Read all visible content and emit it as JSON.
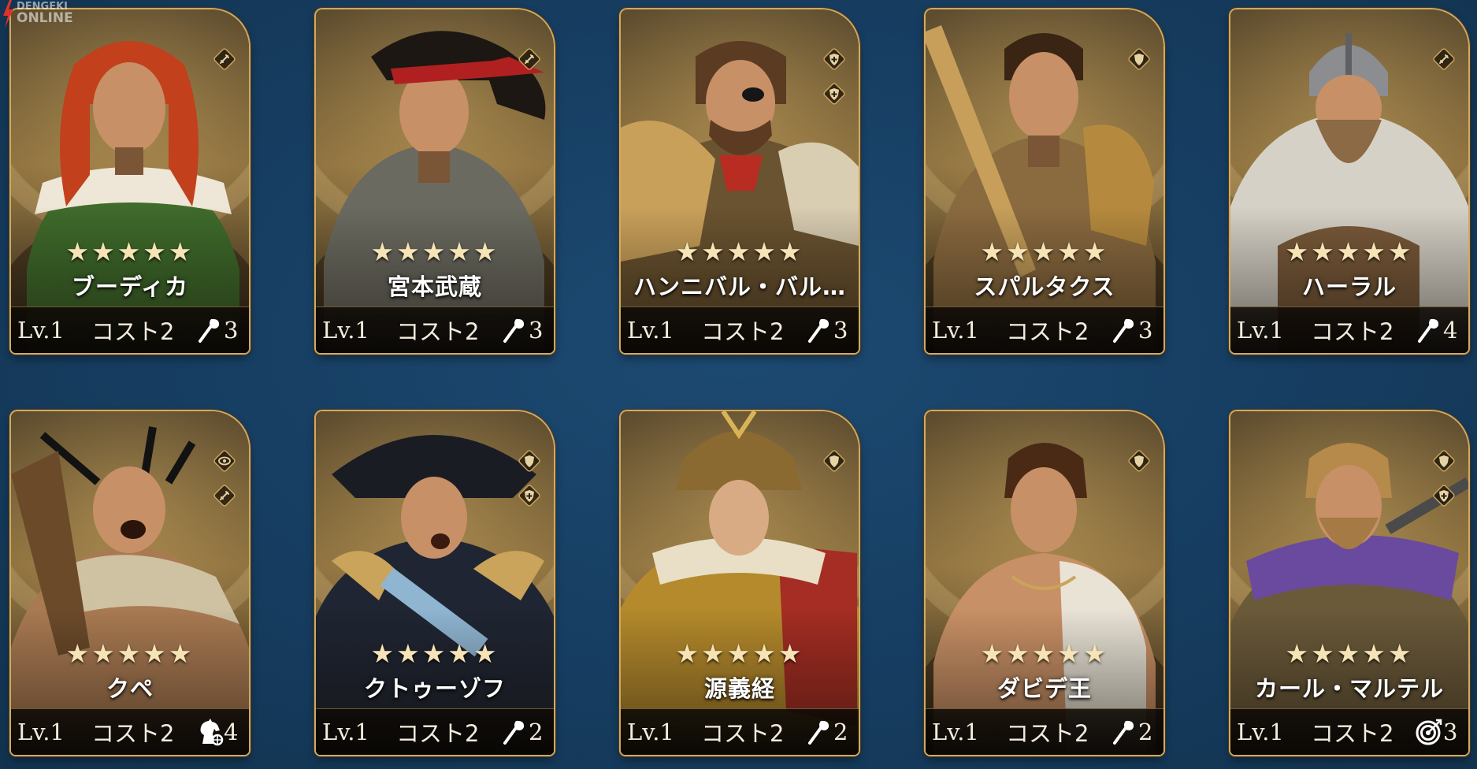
{
  "watermark": {
    "line1": "DENGEKI",
    "line2": "ONLINE"
  },
  "cards": [
    {
      "name": "ブーディカ",
      "stars": "★★★★★",
      "level": "Lv.1",
      "cost": "コスト2",
      "unit_icon": "spear-icon",
      "unit_count": "3",
      "trait_icons": [
        "sword-badge-icon"
      ],
      "portrait": "red-haired-warrior-woman"
    },
    {
      "name": "宮本武蔵",
      "stars": "★★★★★",
      "level": "Lv.1",
      "cost": "コスト2",
      "unit_icon": "spear-icon",
      "unit_count": "3",
      "trait_icons": [
        "sword-badge-icon"
      ],
      "portrait": "samurai-with-headband"
    },
    {
      "name": "ハンニバル・バル…",
      "stars": "★★★★★",
      "level": "Lv.1",
      "cost": "コスト2",
      "unit_icon": "spear-icon",
      "unit_count": "3",
      "trait_icons": [
        "cross-shield-badge-icon",
        "cross-shield-badge-icon"
      ],
      "portrait": "eyepatch-general"
    },
    {
      "name": "スパルタクス",
      "stars": "★★★★★",
      "level": "Lv.1",
      "cost": "コスト2",
      "unit_icon": "spear-icon",
      "unit_count": "3",
      "trait_icons": [
        "shield-badge-icon"
      ],
      "portrait": "gladiator-with-sword"
    },
    {
      "name": "ハーラル",
      "stars": "★★★★★",
      "level": "Lv.1",
      "cost": "コスト2",
      "unit_icon": "spear-icon",
      "unit_count": "4",
      "trait_icons": [
        "sword-badge-icon"
      ],
      "portrait": "viking-helmet"
    },
    {
      "name": "クペ",
      "stars": "★★★★★",
      "level": "Lv.1",
      "cost": "コスト2",
      "unit_icon": "cavalry-icon",
      "unit_count": "4",
      "trait_icons": [
        "eye-badge-icon",
        "sword-badge-icon"
      ],
      "portrait": "feathered-warrior"
    },
    {
      "name": "クトゥーゾフ",
      "stars": "★★★★★",
      "level": "Lv.1",
      "cost": "コスト2",
      "unit_icon": "spear-icon",
      "unit_count": "2",
      "trait_icons": [
        "shield-badge-icon",
        "cross-shield-badge-icon"
      ],
      "portrait": "bicorne-officer"
    },
    {
      "name": "源義経",
      "stars": "★★★★★",
      "level": "Lv.1",
      "cost": "コスト2",
      "unit_icon": "spear-icon",
      "unit_count": "2",
      "trait_icons": [
        "shield-badge-icon"
      ],
      "portrait": "samurai-armor"
    },
    {
      "name": "ダビデ王",
      "stars": "★★★★★",
      "level": "Lv.1",
      "cost": "コスト2",
      "unit_icon": "spear-icon",
      "unit_count": "2",
      "trait_icons": [
        "shield-badge-icon"
      ],
      "portrait": "young-king"
    },
    {
      "name": "カール・マルテル",
      "stars": "★★★★★",
      "level": "Lv.1",
      "cost": "コスト2",
      "unit_icon": "target-icon",
      "unit_count": "3",
      "trait_icons": [
        "shield-badge-icon",
        "cross-shield-badge-icon"
      ],
      "portrait": "bearded-frank"
    }
  ],
  "colors": {
    "background": "#163d61",
    "card_border": "#d0a962",
    "star": "#f6e4b6",
    "text": "#ffffff"
  }
}
